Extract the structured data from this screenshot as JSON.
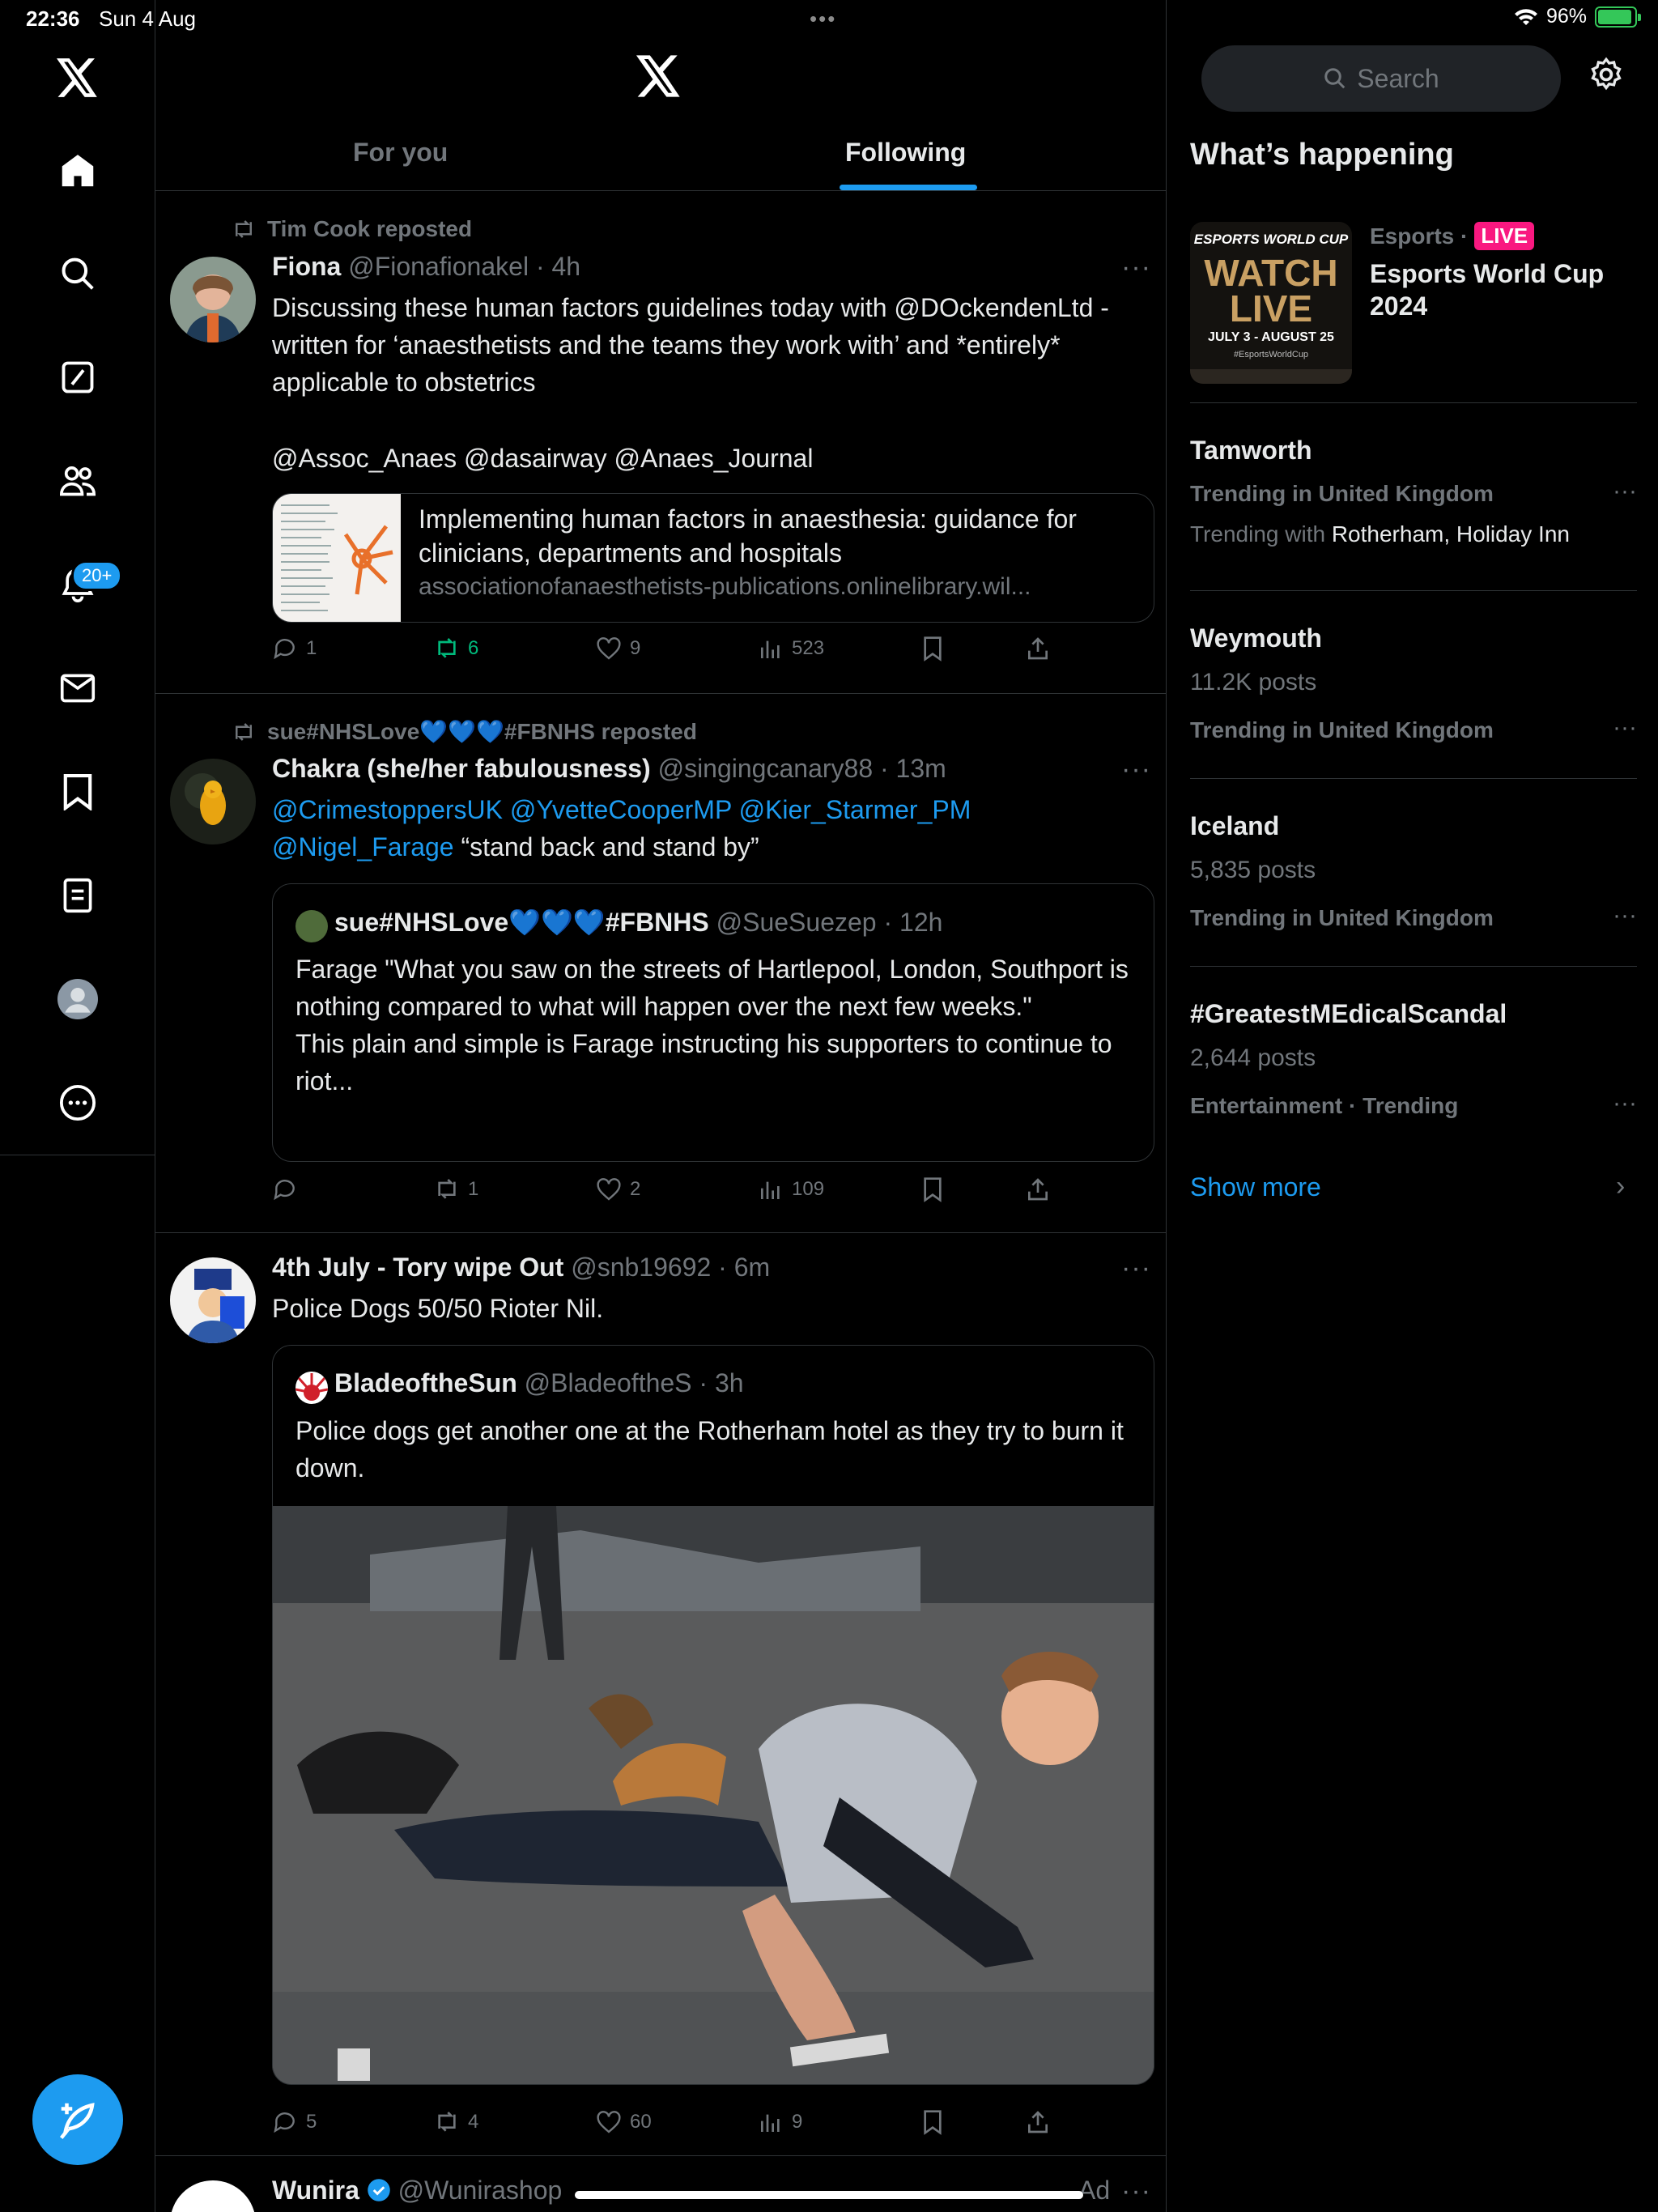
{
  "status": {
    "time": "22:36",
    "date": "Sun 4 Aug",
    "dots": "•••",
    "battery": "96%"
  },
  "nav": {
    "notifications_badge": "20+",
    "items": [
      "home-icon",
      "search-icon",
      "grok-icon",
      "communities-icon",
      "notifications-icon",
      "messages-icon",
      "bookmarks-icon",
      "lists-icon",
      "profile-icon",
      "more-icon"
    ]
  },
  "tabs": {
    "for_you": "For you",
    "following": "Following"
  },
  "posts": [
    {
      "repost_by": "Tim Cook reposted",
      "name": "Fiona",
      "handle": "@Fionafionakel",
      "time": "· 4h",
      "text_a": "Discussing these human factors guidelines today with @DOckendenLtd - written for ‘anaesthetists and the teams they work with’ and *entirely* applicable to obstetrics",
      "text_b": "@Assoc_Anaes @dasairway @Anaes_Journal",
      "card_title": "Implementing human factors in anaesthesia: guidance for clinicians, departments and hospitals",
      "card_url": "associationofanaesthetists-publications.onlinelibrary.wil...",
      "replies": "1",
      "reposts": "6",
      "likes": "9",
      "views": "523"
    },
    {
      "repost_by": "sue#NHSLove💙💙💙#FBNHS reposted",
      "name": "Chakra (she/her fabulousness)",
      "handle": "@singingcanary88",
      "time": "· 13m",
      "mentions_line1": "@CrimestoppersUK @YvetteCooperMP @Kier_Starmer_PM",
      "mention_line2": "@Nigel_Farage",
      "text_tail": " “stand back and stand by”",
      "quote_name": "sue#NHSLove💙💙💙#FBNHS",
      "quote_handle": "@SueSuezep",
      "quote_time": "· 12h",
      "quote_text": "Farage \"What you saw on the streets of Hartlepool, London, Southport is nothing compared to what will happen over the next few weeks.\"\nThis plain and simple is Farage instructing his supporters to continue to riot...",
      "replies": "",
      "reposts": "1",
      "likes": "2",
      "views": "109"
    },
    {
      "name": "4th July - Tory wipe Out",
      "handle": "@snb19692",
      "time": "· 6m",
      "text": "Police Dogs 50/50 Rioter Nil.",
      "quote_name": "BladeoftheSun",
      "quote_handle": "@BladeoftheS",
      "quote_time": "· 3h",
      "quote_text": "Police dogs get another one at the Rotherham hotel as they try to burn it down.",
      "replies": "5",
      "reposts": "4",
      "likes": "60",
      "views": "9"
    },
    {
      "name": "Wunira",
      "handle": "@Wunirashop",
      "ad": "Ad"
    }
  ],
  "sidebar": {
    "search_placeholder": "Search",
    "title": "What’s happening",
    "featured": {
      "category": "Esports ·",
      "live": "LIVE",
      "title": "Esports World Cup 2024",
      "image_text_1": "ESPORTS WORLD CUP",
      "image_text_2": "WATCH",
      "image_text_3": "LIVE",
      "image_text_4": "JULY 3 - AUGUST 25",
      "image_text_5": "#EsportsWorldCup"
    },
    "trends": [
      {
        "topic": "Tamworth",
        "context": "Trending in United Kingdom",
        "with_label": "Trending with ",
        "with_value": "Rotherham, Holiday Inn"
      },
      {
        "topic": "Weymouth",
        "posts": "11.2K posts",
        "context": "Trending in United Kingdom"
      },
      {
        "topic": "Iceland",
        "posts": "5,835 posts",
        "context": "Trending in United Kingdom"
      },
      {
        "topic": "#GreatestMEdicalScandal",
        "posts": "2,644 posts",
        "context": "Entertainment · Trending"
      }
    ],
    "show_more": "Show more"
  },
  "colors": {
    "accent": "#1d9bf0",
    "repost_active": "#00ba7c",
    "live": "#f91880"
  }
}
